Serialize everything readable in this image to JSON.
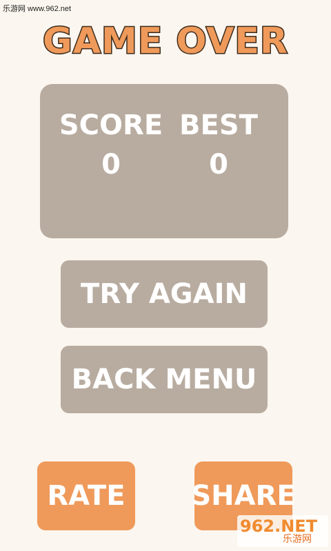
{
  "watermark": {
    "top_text": "乐游网 www.962.net",
    "logo_main": "962.NET",
    "logo_sub": "乐游网"
  },
  "screen": {
    "title": "GAME OVER"
  },
  "scores": {
    "score_label": "SCORE",
    "score_value": "0",
    "best_label": "BEST",
    "best_value": "0"
  },
  "buttons": {
    "try_again": "TRY AGAIN",
    "back_menu": "BACK MENU",
    "rate": "RATE",
    "share": "SHARE"
  },
  "colors": {
    "background": "#fbf6ef",
    "panel": "#b8aca0",
    "accent": "#ef9a5a",
    "title_outline": "#3a2a1c",
    "text_light": "#ffffff"
  }
}
